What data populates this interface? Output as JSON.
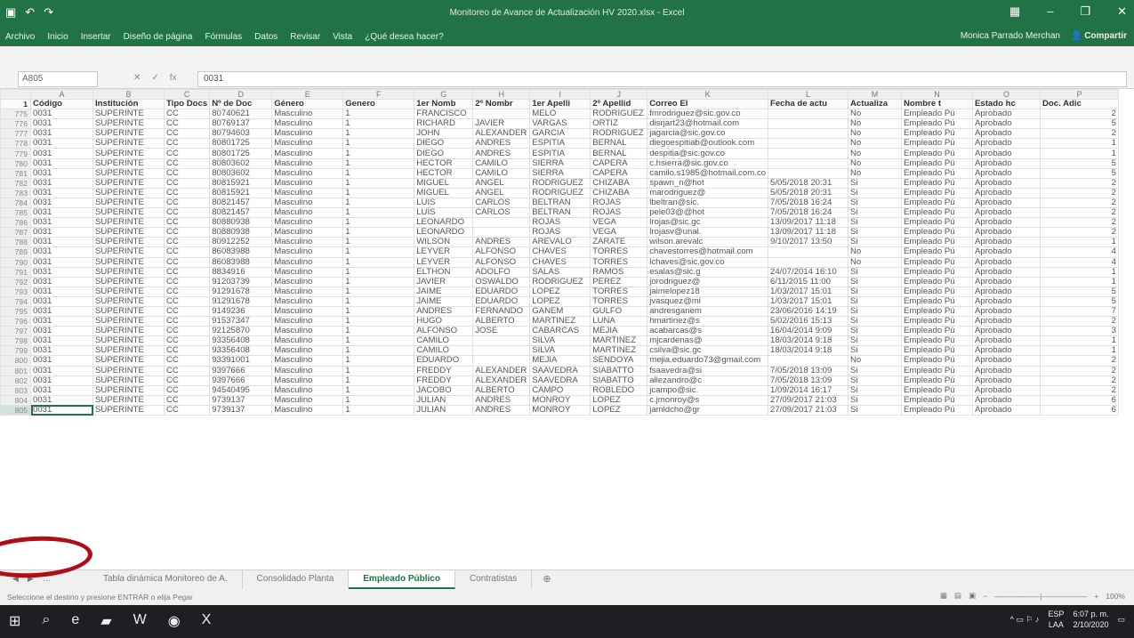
{
  "window": {
    "title": "Monitoreo de Avance de Actualización HV 2020.xlsx - Excel",
    "user": "Monica Parrado Merchan",
    "share": "Compartir"
  },
  "ribbon": {
    "tabs": [
      "Archivo",
      "Inicio",
      "Insertar",
      "Diseño de página",
      "Fórmulas",
      "Datos",
      "Revisar",
      "Vista",
      "¿Qué desea hacer?"
    ]
  },
  "formula": {
    "namebox": "A805",
    "fx": "fx",
    "value": "0031"
  },
  "columns": [
    "A",
    "B",
    "C",
    "D",
    "E",
    "F",
    "G",
    "H",
    "I",
    "J",
    "K",
    "L",
    "M",
    "N",
    "O",
    "P"
  ],
  "headers": [
    "Código",
    "Institución",
    "Tipo Docs",
    "Nº de Doc",
    "Género",
    "Genero",
    "1er Nomb",
    "2º Nombr",
    "1er Apelli",
    "2º Apellid",
    "Correo El",
    "Fecha de actu",
    "Actualiza",
    "Nombre t",
    "Estado hc",
    "Doc. Adic"
  ],
  "rows": [
    {
      "n": "775",
      "d": "80740621",
      "g": "FRANCISCO",
      "h": "",
      "i": "MELO",
      "j": "RODRIGUEZ",
      "k": "fmrodriguez@sic.gov.co",
      "l": "",
      "m": "No",
      "p": "2"
    },
    {
      "n": "776",
      "d": "80769137",
      "g": "RICHARD",
      "h": "JAVIER",
      "i": "VARGAS",
      "j": "ORTIZ",
      "k": "disrjart23@hotmail.com",
      "l": "",
      "m": "No",
      "p": "5"
    },
    {
      "n": "777",
      "d": "80794603",
      "g": "JOHN",
      "h": "ALEXANDER",
      "i": "GARCIA",
      "j": "RODRIGUEZ",
      "k": "jagarcia@sic.gov.co",
      "l": "",
      "m": "No",
      "p": "2"
    },
    {
      "n": "778",
      "d": "80801725",
      "g": "DIEGO",
      "h": "ANDRES",
      "i": "ESPITIA",
      "j": "BERNAL",
      "k": "diegoespitiab@outlook.com",
      "l": "",
      "m": "No",
      "p": "1"
    },
    {
      "n": "779",
      "d": "80801725",
      "g": "DIEGO",
      "h": "ANDRES",
      "i": "ESPITIA",
      "j": "BERNAL",
      "k": "despitia@sic.gov.co",
      "l": "",
      "m": "No",
      "p": "1"
    },
    {
      "n": "780",
      "d": "80803602",
      "g": "HECTOR",
      "h": "CAMILO",
      "i": "SIERRA",
      "j": "CAPERA",
      "k": "c.hsierra@sic.gov.co",
      "l": "",
      "m": "No",
      "p": "5"
    },
    {
      "n": "781",
      "d": "80803602",
      "g": "HECTOR",
      "h": "CAMILO",
      "i": "SIERRA",
      "j": "CAPERA",
      "k": "camilo.s1985@hotmail.com.co",
      "l": "",
      "m": "No",
      "p": "5"
    },
    {
      "n": "782",
      "d": "80815921",
      "g": "MIGUEL",
      "h": "ANGEL",
      "i": "RODRIGUEZ",
      "j": "CHIZABA",
      "k": "spawn_n@hot",
      "l": "5/05/2018 20:31",
      "m": "Si",
      "p": "2"
    },
    {
      "n": "783",
      "d": "80815921",
      "g": "MIGUEL",
      "h": "ANGEL",
      "i": "RODRIGUEZ",
      "j": "CHIZABA",
      "k": "marodriguez@",
      "l": "5/05/2018 20:31",
      "m": "Si",
      "p": "2"
    },
    {
      "n": "784",
      "d": "80821457",
      "g": "LUIS",
      "h": "CARLOS",
      "i": "BELTRAN",
      "j": "ROJAS",
      "k": "lbeltran@sic.",
      "l": "7/05/2018 16:24",
      "m": "Si",
      "p": "2"
    },
    {
      "n": "785",
      "d": "80821457",
      "g": "LUIS",
      "h": "CARLOS",
      "i": "BELTRAN",
      "j": "ROJAS",
      "k": "pele03@@hot",
      "l": "7/05/2018 16:24",
      "m": "Si",
      "p": "2"
    },
    {
      "n": "786",
      "d": "80880938",
      "g": "LEONARDO",
      "h": "",
      "i": "ROJAS",
      "j": "VEGA",
      "k": "lrojas@sic.gc",
      "l": "13/09/2017 11:18",
      "m": "Si",
      "p": "2"
    },
    {
      "n": "787",
      "d": "80880938",
      "g": "LEONARDO",
      "h": "",
      "i": "ROJAS",
      "j": "VEGA",
      "k": "lrojasv@unal.",
      "l": "13/09/2017 11:18",
      "m": "Si",
      "p": "2"
    },
    {
      "n": "788",
      "d": "80912252",
      "g": "WILSON",
      "h": "ANDRES",
      "i": "AREVALO",
      "j": "ZARATE",
      "k": "wilson.arevalc",
      "l": "9/10/2017 13:50",
      "m": "Si",
      "p": "1"
    },
    {
      "n": "789",
      "d": "86083988",
      "g": "LEYVER",
      "h": "ALFONSO",
      "i": "CHAVES",
      "j": "TORRES",
      "k": "chavestorres@hotmail.com",
      "l": "",
      "m": "No",
      "p": "4"
    },
    {
      "n": "790",
      "d": "86083988",
      "g": "LEYVER",
      "h": "ALFONSO",
      "i": "CHAVES",
      "j": "TORRES",
      "k": "lchaves@sic.gov.co",
      "l": "",
      "m": "No",
      "p": "4"
    },
    {
      "n": "791",
      "d": "8834916",
      "g": "ELTHON",
      "h": "ADOLFO",
      "i": "SALAS",
      "j": "RAMOS",
      "k": "esalas@sic.g",
      "l": "24/07/2014 16:10",
      "m": "Si",
      "p": "1"
    },
    {
      "n": "792",
      "d": "91203739",
      "g": "JAVIER",
      "h": "OSWALDO",
      "i": "RODRIGUEZ",
      "j": "PEREZ",
      "k": "jorodriguez@",
      "l": "6/11/2015 11:00",
      "m": "Si",
      "p": "1"
    },
    {
      "n": "793",
      "d": "91291678",
      "g": "JAIME",
      "h": "EDUARDO",
      "i": "LOPEZ",
      "j": "TORRES",
      "k": "jaimelopez18",
      "l": "1/03/2017 15:01",
      "m": "Si",
      "p": "5"
    },
    {
      "n": "794",
      "d": "91291678",
      "g": "JAIME",
      "h": "EDUARDO",
      "i": "LOPEZ",
      "j": "TORRES",
      "k": "jvasquez@mi",
      "l": "1/03/2017 15:01",
      "m": "Si",
      "p": "5"
    },
    {
      "n": "795",
      "d": "9149236",
      "g": "ANDRES",
      "h": "FERNANDO",
      "i": "GANEM",
      "j": "GULFO",
      "k": "andresganem",
      "l": "23/06/2016 14:19",
      "m": "Si",
      "p": "7"
    },
    {
      "n": "796",
      "d": "91537347",
      "g": "HUGO",
      "h": "ALBERTO",
      "i": "MARTINEZ",
      "j": "LUNA",
      "k": "hmartinez@s",
      "l": "5/02/2016 15:13",
      "m": "Si",
      "p": "2"
    },
    {
      "n": "797",
      "d": "92125870",
      "g": "ALFONSO",
      "h": "JOSE",
      "i": "CABARCAS",
      "j": "MEJIA",
      "k": "acabarcas@s",
      "l": "16/04/2014 9:09",
      "m": "Si",
      "p": "3"
    },
    {
      "n": "798",
      "d": "93356408",
      "g": "CAMILO",
      "h": "",
      "i": "SILVA",
      "j": "MARTINEZ",
      "k": "mjcardenas@",
      "l": "18/03/2014 9:18",
      "m": "Si",
      "p": "1"
    },
    {
      "n": "799",
      "d": "93356408",
      "g": "CAMILO",
      "h": "",
      "i": "SILVA",
      "j": "MARTINEZ",
      "k": "csilva@sic.gc",
      "l": "18/03/2014 9:18",
      "m": "Si",
      "p": "1"
    },
    {
      "n": "800",
      "d": "93391001",
      "g": "EDUARDO",
      "h": "",
      "i": "MEJIA",
      "j": "SENDOYA",
      "k": "mejia.eduardo73@gmail.com",
      "l": "",
      "m": "No",
      "p": "2"
    },
    {
      "n": "801",
      "d": "9397666",
      "g": "FREDDY",
      "h": "ALEXANDER",
      "i": "SAAVEDRA",
      "j": "SIABATTO",
      "k": "fsaavedra@si",
      "l": "7/05/2018 13:09",
      "m": "Si",
      "p": "2"
    },
    {
      "n": "802",
      "d": "9397666",
      "g": "FREDDY",
      "h": "ALEXANDER",
      "i": "SAAVEDRA",
      "j": "SIABATTO",
      "k": "allezandro@c",
      "l": "7/05/2018 13:09",
      "m": "Si",
      "p": "2"
    },
    {
      "n": "803",
      "d": "94540495",
      "g": "JACOBO",
      "h": "ALBERTO",
      "i": "CAMPO",
      "j": "ROBLEDO",
      "k": "jcampo@sic.",
      "l": "1/09/2014 16:17",
      "m": "Si",
      "p": "2"
    },
    {
      "n": "804",
      "d": "9739137",
      "g": "JULIAN",
      "h": "ANDRES",
      "i": "MONROY",
      "j": "LOPEZ",
      "k": "c.jmonroy@s",
      "l": "27/09/2017 21:03",
      "m": "Si",
      "p": "6"
    },
    {
      "n": "805",
      "d": "9739137",
      "g": "JULIAN",
      "h": "ANDRES",
      "i": "MONROY",
      "j": "LOPEZ",
      "k": "jamldcho@gr",
      "l": "27/09/2017 21:03",
      "m": "Si",
      "p": "6"
    }
  ],
  "common": {
    "code": "0031",
    "inst": "SUPERINTE",
    "tipo": "CC",
    "genero": "Masculino",
    "genero2": "1",
    "nombre": "Empleado Pú",
    "estado": "Aprobado"
  },
  "sheets": [
    "Tabla dinámica Monitoreo de A.",
    "Consolidado Planta",
    "Empleado Público",
    "Contratistas"
  ],
  "status": {
    "message": "Seleccione el destino y presione ENTRAR o elija Pegar",
    "zoom": "100%"
  },
  "taskbar": {
    "lang": "ESP",
    "layout": "LAA",
    "time": "6:07 p. m.",
    "date": "2/10/2020"
  }
}
